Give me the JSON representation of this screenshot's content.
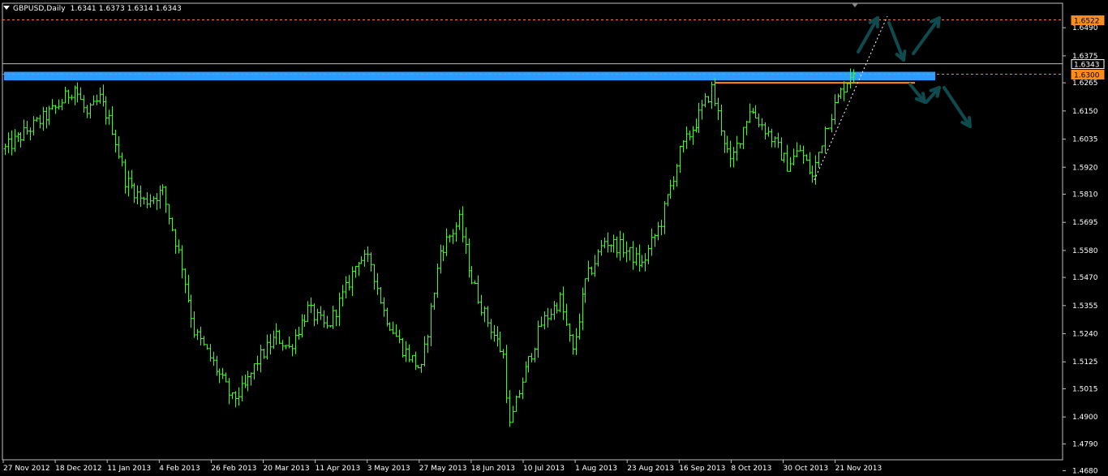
{
  "header": {
    "symbol": "GBPUSD,Daily",
    "ohlc": "1.6341 1.6373 1.6314 1.6343"
  },
  "colors": {
    "background": "#000000",
    "bars": "#39ff14",
    "axis": "#c0c0c0",
    "grid_text": "#ffffff",
    "resistance_zone": "#2f9cff",
    "resistance_line": "#ff8c1a",
    "dashed_levels": "#ff7a2a",
    "arrows": "#0f4a4f",
    "trendline": "#ffffff"
  },
  "chart_data": {
    "type": "ohlc",
    "title": "GBPUSD,Daily",
    "ylim": [
      1.4725,
      1.659
    ],
    "y_ticks": [
      "1.6490",
      "1.6375",
      "1.6265",
      "1.6150",
      "1.6035",
      "1.5920",
      "1.5810",
      "1.5695",
      "1.5580",
      "1.5470",
      "1.5355",
      "1.5240",
      "1.5125",
      "1.5015",
      "1.4900",
      "1.4790",
      "1.4680"
    ],
    "x_ticks": [
      "27 Nov 2012",
      "18 Dec 2012",
      "11 Jan 2013",
      "4 Feb 2013",
      "26 Feb 2013",
      "20 Mar 2013",
      "11 Apr 2013",
      "3 May 2013",
      "27 May 2013",
      "18 Jun 2013",
      "10 Jul 2013",
      "1 Aug 2013",
      "23 Aug 2013",
      "16 Sep 2013",
      "8 Oct 2013",
      "30 Oct 2013",
      "21 Nov 2013"
    ],
    "bar_count": 270,
    "close_path_anchors": [
      {
        "bar": 0,
        "price": 1.5995
      },
      {
        "bar": 8,
        "price": 1.608
      },
      {
        "bar": 16,
        "price": 1.616
      },
      {
        "bar": 22,
        "price": 1.625
      },
      {
        "bar": 26,
        "price": 1.613
      },
      {
        "bar": 30,
        "price": 1.62
      },
      {
        "bar": 34,
        "price": 1.608
      },
      {
        "bar": 38,
        "price": 1.587
      },
      {
        "bar": 44,
        "price": 1.578
      },
      {
        "bar": 50,
        "price": 1.582
      },
      {
        "bar": 56,
        "price": 1.552
      },
      {
        "bar": 60,
        "price": 1.525
      },
      {
        "bar": 66,
        "price": 1.512
      },
      {
        "bar": 72,
        "price": 1.497
      },
      {
        "bar": 76,
        "price": 1.502
      },
      {
        "bar": 80,
        "price": 1.513
      },
      {
        "bar": 86,
        "price": 1.523
      },
      {
        "bar": 90,
        "price": 1.518
      },
      {
        "bar": 96,
        "price": 1.534
      },
      {
        "bar": 102,
        "price": 1.526
      },
      {
        "bar": 108,
        "price": 1.542
      },
      {
        "bar": 112,
        "price": 1.555
      },
      {
        "bar": 116,
        "price": 1.553
      },
      {
        "bar": 120,
        "price": 1.533
      },
      {
        "bar": 126,
        "price": 1.518
      },
      {
        "bar": 132,
        "price": 1.509
      },
      {
        "bar": 138,
        "price": 1.558
      },
      {
        "bar": 144,
        "price": 1.57
      },
      {
        "bar": 148,
        "price": 1.546
      },
      {
        "bar": 152,
        "price": 1.532
      },
      {
        "bar": 158,
        "price": 1.515
      },
      {
        "bar": 160,
        "price": 1.486
      },
      {
        "bar": 164,
        "price": 1.505
      },
      {
        "bar": 170,
        "price": 1.528
      },
      {
        "bar": 176,
        "price": 1.538
      },
      {
        "bar": 180,
        "price": 1.516
      },
      {
        "bar": 184,
        "price": 1.545
      },
      {
        "bar": 190,
        "price": 1.562
      },
      {
        "bar": 196,
        "price": 1.559
      },
      {
        "bar": 202,
        "price": 1.552
      },
      {
        "bar": 208,
        "price": 1.57
      },
      {
        "bar": 214,
        "price": 1.598
      },
      {
        "bar": 220,
        "price": 1.613
      },
      {
        "bar": 224,
        "price": 1.624
      },
      {
        "bar": 230,
        "price": 1.593
      },
      {
        "bar": 236,
        "price": 1.616
      },
      {
        "bar": 242,
        "price": 1.606
      },
      {
        "bar": 248,
        "price": 1.593
      },
      {
        "bar": 252,
        "price": 1.599
      },
      {
        "bar": 256,
        "price": 1.588
      },
      {
        "bar": 260,
        "price": 1.608
      },
      {
        "bar": 264,
        "price": 1.62
      },
      {
        "bar": 268,
        "price": 1.63
      },
      {
        "bar": 270,
        "price": 1.6343
      }
    ],
    "price_labels": [
      {
        "price": 1.6522,
        "text": "1.6522",
        "style": "orange"
      },
      {
        "price": 1.6343,
        "text": "1.6343",
        "style": "white"
      },
      {
        "price": 1.63,
        "text": "1.6300",
        "style": "orange"
      }
    ],
    "resistance_zone": {
      "from": 1.6275,
      "to": 1.631
    },
    "resistance_line": {
      "price": 1.6265
    },
    "dashed_levels": [
      1.6522,
      1.63
    ],
    "current_level": 1.6343
  }
}
